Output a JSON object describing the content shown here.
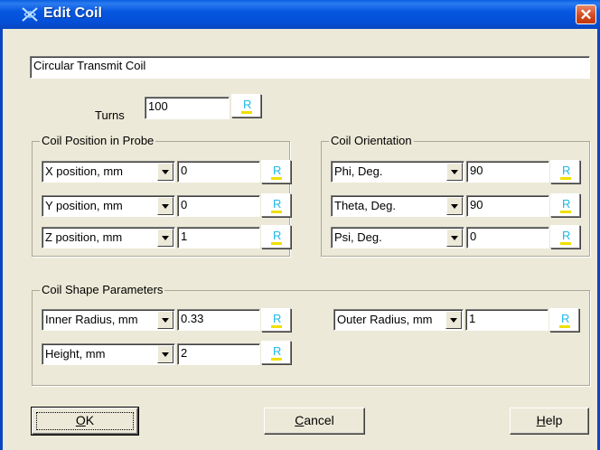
{
  "window": {
    "title": "Edit Coil",
    "icon": "coil-app-icon",
    "close_glyph": "✕"
  },
  "coil_name": "Circular Transmit Coil",
  "turns": {
    "label": "Turns",
    "value": "100"
  },
  "r_button_label": "R",
  "position_group": {
    "label": "Coil Position in Probe",
    "rows": [
      {
        "field": "X position, mm",
        "value": "0"
      },
      {
        "field": "Y position, mm",
        "value": "0"
      },
      {
        "field": "Z position, mm",
        "value": "1"
      }
    ]
  },
  "orientation_group": {
    "label": "Coil Orientation",
    "rows": [
      {
        "field": "Phi, Deg.",
        "value": "90"
      },
      {
        "field": "Theta, Deg.",
        "value": "90"
      },
      {
        "field": "Psi, Deg.",
        "value": "0"
      }
    ]
  },
  "shape_group": {
    "label": "Coil Shape Parameters",
    "inner_radius": {
      "field": "Inner Radius, mm",
      "value": "0.33"
    },
    "height": {
      "field": "Height, mm",
      "value": "2"
    },
    "outer_radius": {
      "field": "Outer Radius, mm",
      "value": "1"
    }
  },
  "buttons": {
    "ok_mnemonic": "O",
    "ok_rest": "K",
    "cancel_mnemonic": "C",
    "cancel_rest": "ancel",
    "help_mnemonic": "H",
    "help_rest": "elp"
  }
}
